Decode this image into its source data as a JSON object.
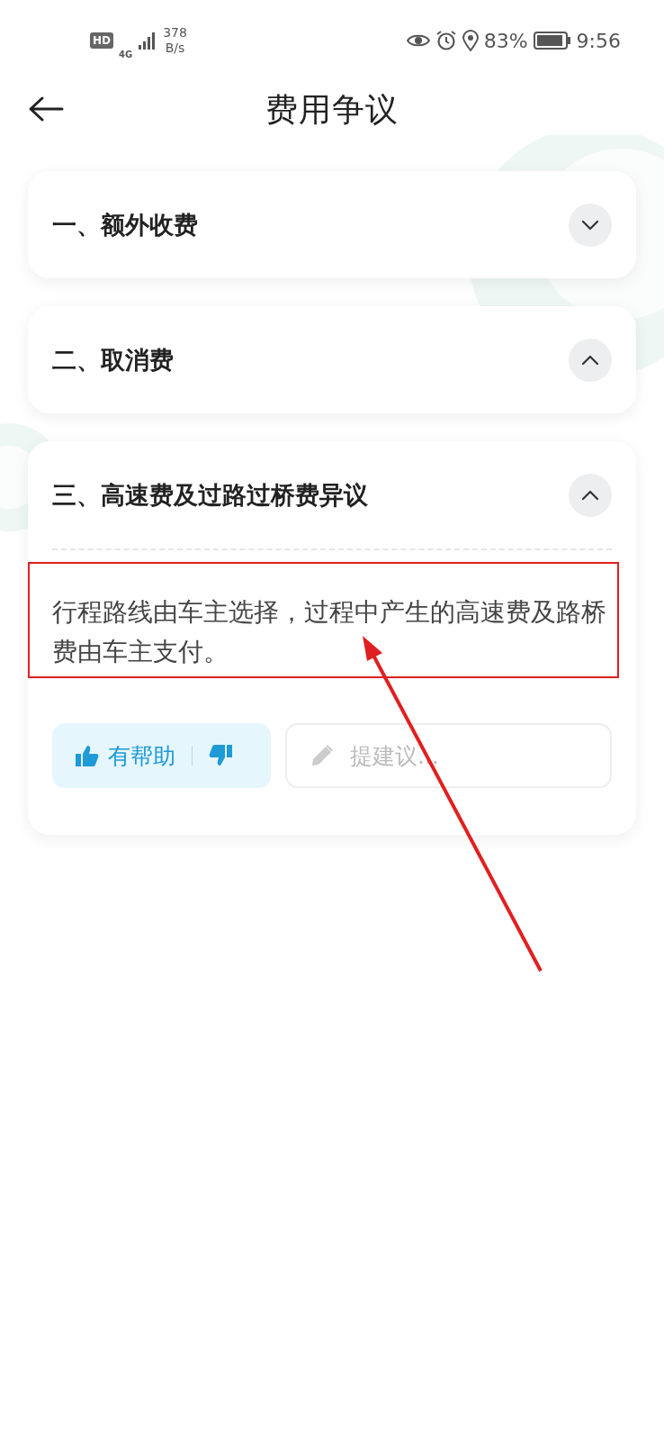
{
  "status_bar": {
    "hd": "HD",
    "network": "4G",
    "speed_value": "378",
    "speed_unit": "B/s",
    "battery": "83%",
    "time": "9:56"
  },
  "header": {
    "title": "费用争议"
  },
  "sections": [
    {
      "title": "一、额外收费",
      "expanded": false
    },
    {
      "title": "二、取消费",
      "expanded": true
    },
    {
      "title": "三、高速费及过路过桥费异议",
      "expanded": true,
      "body": "行程路线由车主选择，过程中产生的高速费及路桥费由车主支付。",
      "feedback": {
        "helpful": "有帮助",
        "suggest_placeholder": "提建议..."
      }
    }
  ]
}
